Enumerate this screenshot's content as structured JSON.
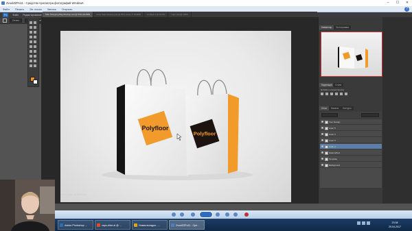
{
  "viewer": {
    "title": "ZvuulZZPo11 - Средство просмотра фотографий Windows",
    "menu": [
      "Файл",
      "Печать",
      "Эл. почта",
      "Запись",
      "Открыть"
    ]
  },
  "photoshop": {
    "menu": [
      "Ps",
      "Файл",
      "Редактирование",
      "Изображение",
      "Слои",
      "Текст",
      "Выделение",
      "Фильтр",
      "3D",
      "Просмотр",
      "Окно",
      "Справка"
    ],
    "options": [
      "Оттен.",
      "Нормальный",
      "Ширина",
      "Высота",
      "Уточн. край..."
    ],
    "doc_tabs": [
      "Sale Shopping Bag Mockup.psd @ 50% (RGB/8)",
      "Color Sale Mockup.psd @ 50% (Color 5, RGB/8)",
      "Untitled-1 @ 33.3%",
      "Logo.psd @ 100%"
    ],
    "zoom": "16,67%  Док: 48,3M/91,3M",
    "panels": {
      "navigator_tabs": [
        "Навигатор",
        "Гистограмма"
      ],
      "adjust_tabs": [
        "Коррекция",
        "Стили"
      ],
      "adjust_title": "Добавить корректировку",
      "layers_tabs": [
        "Слои",
        "Каналы",
        "Контуры"
      ],
      "layers": [
        {
          "name": "Your Design",
          "selected": false
        },
        {
          "name": "Color 5",
          "selected": false
        },
        {
          "name": "Color 4",
          "selected": false
        },
        {
          "name": "Color 3",
          "selected": false
        },
        {
          "name": "Color 2",
          "selected": true
        },
        {
          "name": "Glass Effect",
          "selected": false
        },
        {
          "name": "Template",
          "selected": false
        },
        {
          "name": "Background",
          "selected": false
        }
      ]
    },
    "colors": {
      "foreground": "#f0931e",
      "background": "#ffffff"
    }
  },
  "artwork": {
    "brand": "Polyfloor",
    "accent": "#f29a2b",
    "dark": "#1d1410"
  },
  "taskbar": {
    "items": [
      "Adobe Photoshop ...",
      "caps.drive.ai @ ...",
      "Новая вкладка - ...",
      "ZvuulZZPo11 - Сре..."
    ],
    "time": "23:38",
    "date": "29.04.2017"
  }
}
